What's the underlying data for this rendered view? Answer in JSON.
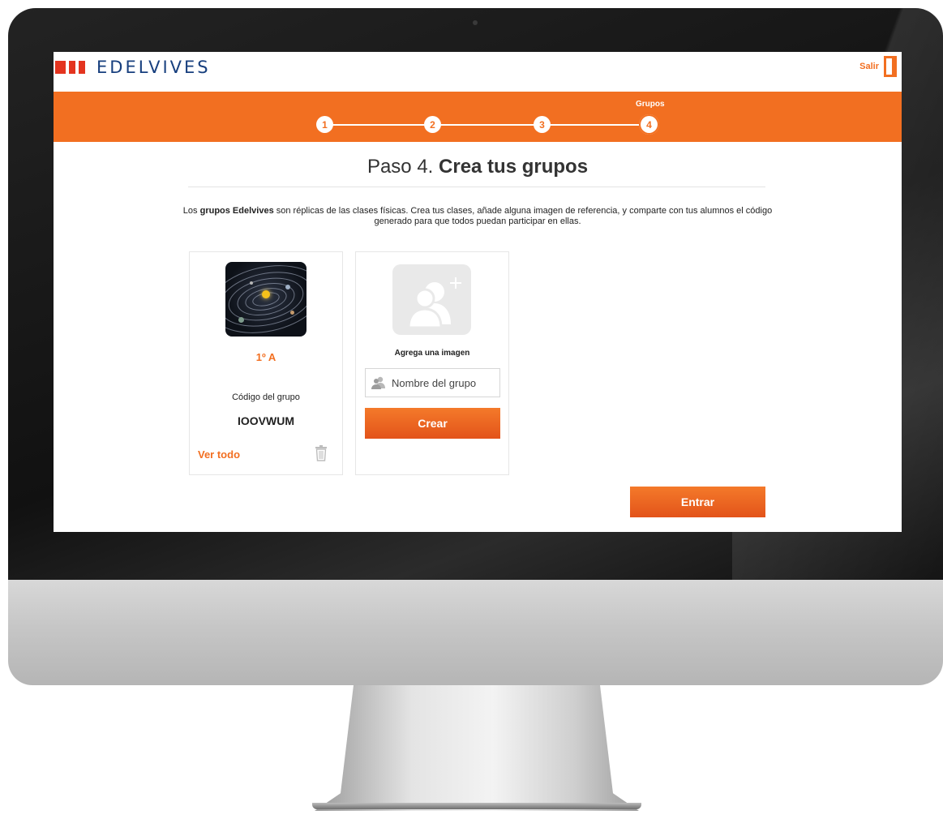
{
  "app": {
    "logo_text": "EDELVIVES",
    "logout_label": "Salir",
    "accent_color": "#f26f21",
    "brand_color": "#173f7e"
  },
  "stepper": {
    "steps": [
      {
        "number": "1"
      },
      {
        "number": "2"
      },
      {
        "number": "3"
      },
      {
        "number": "4",
        "label": "Grupos",
        "active": true
      }
    ]
  },
  "page": {
    "title_prefix": "Paso 4.",
    "title_bold": "Crea tus grupos",
    "intro_before": "Los ",
    "intro_bold": "grupos Edelvives",
    "intro_after": " son réplicas de las clases físicas. Crea tus clases, añade alguna imagen de referencia, y comparte con tus alumnos el código generado para que todos puedan participar en ellas."
  },
  "groups": [
    {
      "name": "1º A",
      "code_label": "Código del grupo",
      "code": "IOOVWUM",
      "view_all_label": "Ver todo"
    }
  ],
  "new_group": {
    "add_image_label": "Agrega una imagen",
    "name_placeholder": "Nombre del grupo",
    "create_label": "Crear"
  },
  "footer": {
    "enter_label": "Entrar"
  }
}
